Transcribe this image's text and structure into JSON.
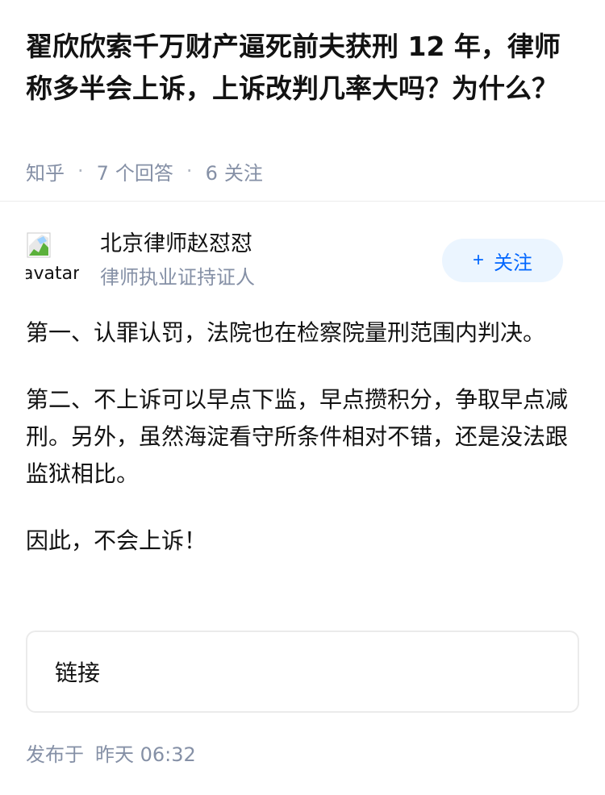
{
  "question": {
    "title": "翟欣欣索千万财产逼死前夫获刑 12 年，律师称多半会上诉，上诉改判几率大吗？为什么？",
    "meta": {
      "platform": "知乎",
      "answer_count": "7",
      "answer_unit": "个回答",
      "follow_count": "6",
      "follow_unit": "关注"
    }
  },
  "author": {
    "avatar_alt": "avatar",
    "name": "北京律师赵怼怼",
    "headline": "律师执业证持证人",
    "follow_label": "关注",
    "follow_icon": "+"
  },
  "answer": {
    "paragraphs": [
      "第一、认罪认罚，法院也在检察院量刑范围内判决。",
      "第二、不上诉可以早点下监，早点攒积分，争取早点减刑。另外，虽然海淀看守所条件相对不错，还是没法跟监狱相比。",
      "因此，不会上诉！"
    ]
  },
  "link_card": {
    "label": "链接"
  },
  "footer": {
    "publish_prefix": "发布于",
    "publish_time": "昨天 06:32"
  },
  "colors": {
    "text_primary": "#121212",
    "text_secondary": "#8590a6",
    "accent": "#0066ff",
    "accent_bg": "#ebf5ff",
    "divider": "#ebebeb"
  }
}
